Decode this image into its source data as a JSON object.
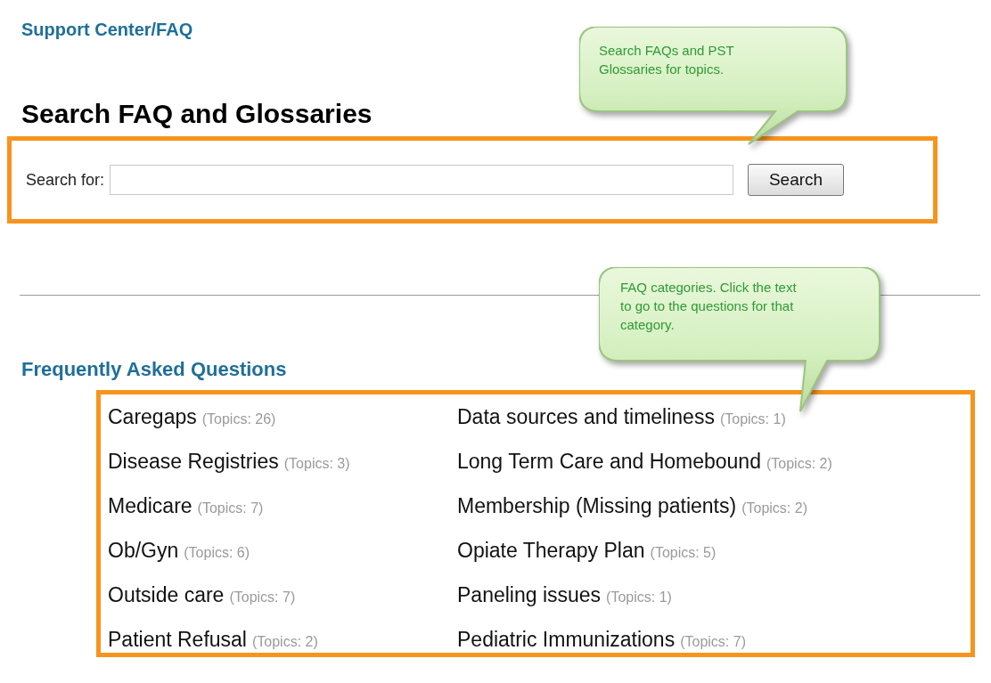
{
  "breadcrumb": "Support Center/FAQ",
  "search_section": {
    "heading": "Search FAQ and Glossaries",
    "label": "Search for:",
    "button": "Search"
  },
  "callouts": [
    {
      "text": "Search FAQs and PST Glossaries for topics."
    },
    {
      "text": "FAQ categories. Click the text to go to the questions for that category."
    }
  ],
  "faq": {
    "heading": "Frequently Asked Questions",
    "categories": [
      {
        "name": "Caregaps",
        "topics": "(Topics: 26)"
      },
      {
        "name": "Data sources and timeliness",
        "topics": "(Topics: 1)"
      },
      {
        "name": "Disease Registries",
        "topics": "(Topics: 3)"
      },
      {
        "name": "Long Term Care and Homebound",
        "topics": "(Topics: 2)"
      },
      {
        "name": "Medicare",
        "topics": "(Topics: 7)"
      },
      {
        "name": "Membership (Missing patients)",
        "topics": "(Topics: 2)"
      },
      {
        "name": "Ob/Gyn",
        "topics": "(Topics: 6)"
      },
      {
        "name": "Opiate Therapy Plan",
        "topics": "(Topics: 5)"
      },
      {
        "name": "Outside care",
        "topics": "(Topics: 7)"
      },
      {
        "name": "Paneling issues",
        "topics": "(Topics: 1)"
      },
      {
        "name": "Patient Refusal",
        "topics": "(Topics: 2)"
      },
      {
        "name": "Pediatric Immunizations",
        "topics": "(Topics: 7)"
      }
    ]
  }
}
